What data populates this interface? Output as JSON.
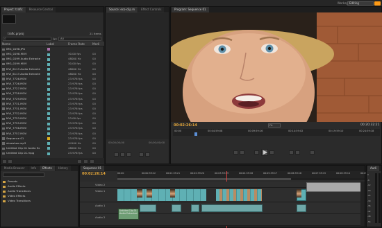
{
  "topbar": {
    "workspace_label": "Workspace:",
    "workspace_value": "Editing",
    "cs_live": "CS Live"
  },
  "project": {
    "tabs": [
      "Project: trafic",
      "Resource Central"
    ],
    "project_file": "trafic.prproj",
    "item_count": "21 Items",
    "in_label": "In:",
    "in_value": "All",
    "columns": [
      "Name",
      "Label",
      "Frame Rate",
      "Medi"
    ],
    "items": [
      {
        "name": "IMG_0198.JPG",
        "label": "#a86fa9",
        "rate": "",
        "media": ""
      },
      {
        "name": "IMG_0198.MOV",
        "label": "#5fb0b4",
        "rate": "30.00 fps",
        "media": "00"
      },
      {
        "name": "IMG_0199 Audio Extracte",
        "label": "#5fb0b4",
        "rate": "48000 Hz",
        "media": "00"
      },
      {
        "name": "IMG_0199.MOV",
        "label": "#5fb0b4",
        "rate": "30.00 fps",
        "media": "00"
      },
      {
        "name": "MVI_6113 Audio Extracte",
        "label": "#5fb0b4",
        "rate": "48000 Hz",
        "media": "00"
      },
      {
        "name": "MVI_6113 Audio Extracte",
        "label": "#5fb0b4",
        "rate": "48000 Hz",
        "media": "00"
      },
      {
        "name": "MVI_7726.MOV",
        "label": "#5fb0b4",
        "rate": "23.976 fps",
        "media": "00"
      },
      {
        "name": "MVI_7726.MOV",
        "label": "#5fb0b4",
        "rate": "23.976 fps",
        "media": "00"
      },
      {
        "name": "MVI_7727.MOV",
        "label": "#5fb0b4",
        "rate": "23.976 fps",
        "media": "00"
      },
      {
        "name": "MVI_7728.MOV",
        "label": "#5fb0b4",
        "rate": "23.976 fps",
        "media": "00"
      },
      {
        "name": "MVI_7729.MOV",
        "label": "#5fb0b4",
        "rate": "23.976 fps",
        "media": "00"
      },
      {
        "name": "MVI_7731.MOV",
        "label": "#5fb0b4",
        "rate": "23.976 fps",
        "media": "00"
      },
      {
        "name": "MVI_7731.MOV",
        "label": "#5fb0b4",
        "rate": "23.976 fps",
        "media": "00"
      },
      {
        "name": "MVI_7732.MOV",
        "label": "#5fb0b4",
        "rate": "23.976 fps",
        "media": "00"
      },
      {
        "name": "MVI_7753.MOV",
        "label": "#5fb0b4",
        "rate": "23.00 fps",
        "media": "00"
      },
      {
        "name": "MVI_7755.MOV",
        "label": "#5fb0b4",
        "rate": "23.976 fps",
        "media": "00"
      },
      {
        "name": "MVI_7756.MOV",
        "label": "#5fb0b4",
        "rate": "23.976 fps",
        "media": "00"
      },
      {
        "name": "MVI_7757.MOV",
        "label": "#5fb0b4",
        "rate": "23.976 fps",
        "media": "00"
      },
      {
        "name": "Sequence 01",
        "label": "#e0b21d",
        "rate": "23.976 fps",
        "media": "00"
      },
      {
        "name": "shoeshox.mp3",
        "label": "#5fb0b4",
        "rate": "44100 Hz",
        "media": "00"
      },
      {
        "name": "Untitled Clip 01 Audio Ex",
        "label": "#5fb0b4",
        "rate": "48000 Hz",
        "media": "00"
      },
      {
        "name": "Untitled Clip 01.mpg",
        "label": "#5fb0b4",
        "rate": "23.976 fps",
        "media": "00"
      }
    ]
  },
  "source": {
    "tabs": [
      "Source: eco-clip.m",
      "Effect Controls"
    ],
    "timecode": "00;00;00;00",
    "timecode_right": "00;00;00;00"
  },
  "program": {
    "tab": "Program: Sequence 01",
    "timecode": "00:02:26:14",
    "fit": "Fit",
    "duration": "00:20:32:21",
    "ruler": [
      "00:00",
      "00:04:59:08",
      "00:09:59:16",
      "00:14:59:02",
      "00:19:59:10",
      "00:24:59:18"
    ]
  },
  "effects": {
    "tabs": [
      "Media Browser",
      "Info",
      "Effects",
      "History"
    ],
    "folders": [
      "Presets",
      "Audio Effects",
      "Audio Transitions",
      "Video Effects",
      "Video Transitions"
    ]
  },
  "timeline": {
    "tab": "Sequence 01",
    "timecode": "00:02:26:14",
    "ruler": [
      "00:00",
      "00:00:59:22",
      "00:01:59:21",
      "00:02:59:20",
      "00:03:59:19",
      "00:04:59:18",
      "00:05:59:17",
      "00:06:59:16",
      "00:07:59:15",
      "00:08:59:14",
      "00:09:59:13"
    ],
    "tracks": [
      "Video 2",
      "Video 1",
      "Audio 1",
      "Audio 2"
    ],
    "clip_label": "Untitled Clip 01 Audio Extracted"
  },
  "audio_meter": {
    "tab": "Audi",
    "marks": [
      "0",
      "-6",
      "-12",
      "-18",
      "-24",
      "-30",
      "-36",
      "-42",
      "-48",
      "-54"
    ]
  }
}
